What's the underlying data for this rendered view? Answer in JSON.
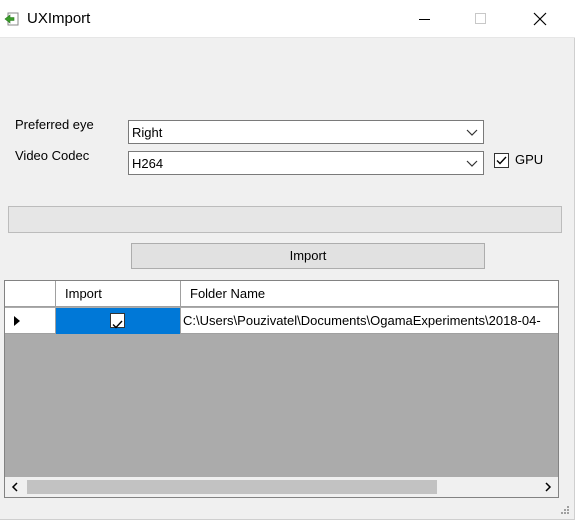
{
  "window": {
    "title": "UXImport",
    "icons": {
      "app": "import-app-icon",
      "minimize": "minimize-icon",
      "maximize": "maximize-icon",
      "close": "close-icon"
    }
  },
  "form": {
    "eye_label": "Preferred eye",
    "eye_value": "Right",
    "codec_label": "Video Codec",
    "codec_value": "H264",
    "gpu_label": "GPU",
    "gpu_checked": true,
    "progress": 0,
    "import_button": "Import"
  },
  "grid": {
    "columns": [
      "",
      "Import",
      "Folder Name"
    ],
    "rows": [
      {
        "import": true,
        "folder": "C:\\Users\\Pouzivatel\\Documents\\OgamaExperiments\\2018-04-"
      }
    ]
  },
  "colors": {
    "selection": "#0078d7",
    "grid_background": "#ababab",
    "window": "#f0f0f0"
  }
}
